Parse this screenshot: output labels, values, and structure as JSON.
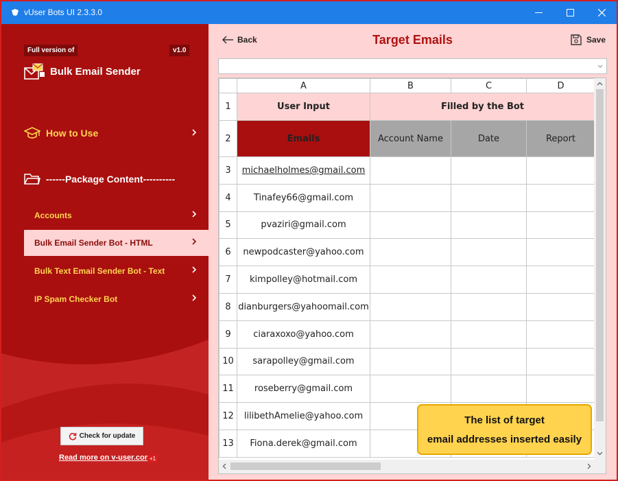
{
  "window": {
    "title": "vUser Bots UI 2.3.3.0",
    "controls": [
      "minimize-icon",
      "maximize-icon",
      "close-icon"
    ]
  },
  "sidebar": {
    "badge_full": "Full version of",
    "badge_version": "v1.0",
    "product_name": "Bulk Email Sender",
    "how_to_use": "How to Use",
    "package_content": "------Package Content----------",
    "items": [
      {
        "label": "Accounts",
        "active": false
      },
      {
        "label": "Bulk Email Sender Bot - HTML",
        "active": true
      },
      {
        "label": "Bulk Text Email Sender Bot - Text",
        "active": false
      },
      {
        "label": "IP Spam Checker Bot",
        "active": false
      }
    ],
    "update_button": "Check for update",
    "read_more": "Read more on v-user.com",
    "badge_plus": "+1"
  },
  "main": {
    "back": "Back",
    "title": "Target Emails",
    "save": "Save",
    "formula_value": ""
  },
  "grid": {
    "columns": [
      "A",
      "B",
      "C",
      "D"
    ],
    "row_numbers": [
      "1",
      "2",
      "3",
      "4",
      "5",
      "6",
      "7",
      "8",
      "9",
      "10",
      "11",
      "12",
      "13"
    ],
    "group_user": "User Input",
    "group_bot": "Filled by the Bot",
    "headers": [
      "Emails",
      "Account Name",
      "Date",
      "Report"
    ],
    "emails": [
      "michaelholmes@gmail.com",
      "Tinafey66@gmail.com",
      "pvaziri@gmail.com",
      "newpodcaster@yahoo.com",
      "kimpolley@hotmail.com",
      "dianburgers@yahoomail.com",
      "ciaraxoxo@yahoo.com",
      "sarapolley@gmail.com",
      "roseberry@gmail.com",
      "lilibethAmelie@yahoo.com",
      "Fiona.derek@gmail.com"
    ]
  },
  "callout": {
    "line1": "The list of target",
    "line2": "email addresses inserted easily"
  },
  "colors": {
    "titlebar": "#1f7ee8",
    "sidebar": "#a90f0f",
    "accent": "#b01111",
    "highlight": "#ffd54f",
    "panel": "#ffd4d4"
  }
}
